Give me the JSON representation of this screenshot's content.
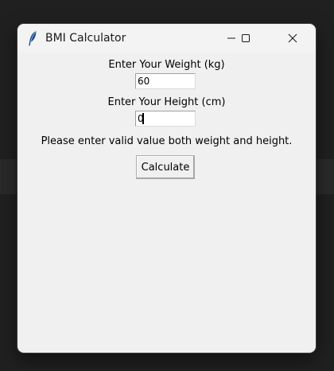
{
  "window": {
    "title": "BMI Calculator",
    "icon": "feather-icon"
  },
  "controls": {
    "minimize_icon": "minimize-icon",
    "maximize_icon": "maximize-icon",
    "close_icon": "close-icon"
  },
  "form": {
    "weight_label": "Enter Your Weight (kg)",
    "weight_value": "60",
    "height_label": "Enter Your Height (cm)",
    "height_value": "0",
    "message": "Please enter valid value both weight and height.",
    "calculate_label": "Calculate"
  },
  "colors": {
    "window_bg": "#f0f0f0",
    "titlebar_bg": "#f3f3f3",
    "desktop_bg": "#202020"
  }
}
